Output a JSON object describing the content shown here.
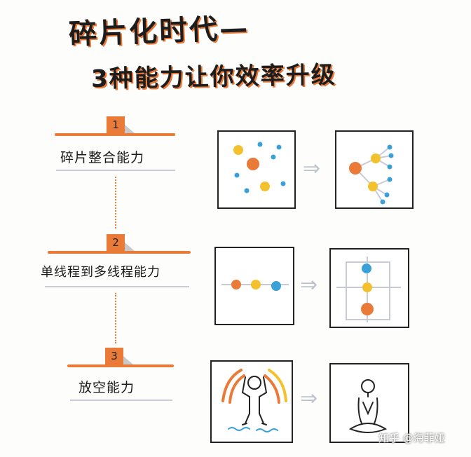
{
  "title": "碎片化时代—",
  "subtitle": "3种能力让你效率升级",
  "steps": [
    {
      "number": "1",
      "label": "碎片整合能力"
    },
    {
      "number": "2",
      "label": "单线程到多线程能力"
    },
    {
      "number": "3",
      "label": "放空能力"
    }
  ],
  "watermark": "知乎 @海菲娅",
  "icons": {
    "arrow": "right-arrow-icon",
    "person_stressed": "stressed-person-icon",
    "person_meditating": "meditating-person-icon"
  },
  "colors": {
    "accent": "#ea7a38",
    "blue": "#3aa0d8",
    "yellow": "#f3c12c",
    "grey": "#c8cbd6"
  }
}
